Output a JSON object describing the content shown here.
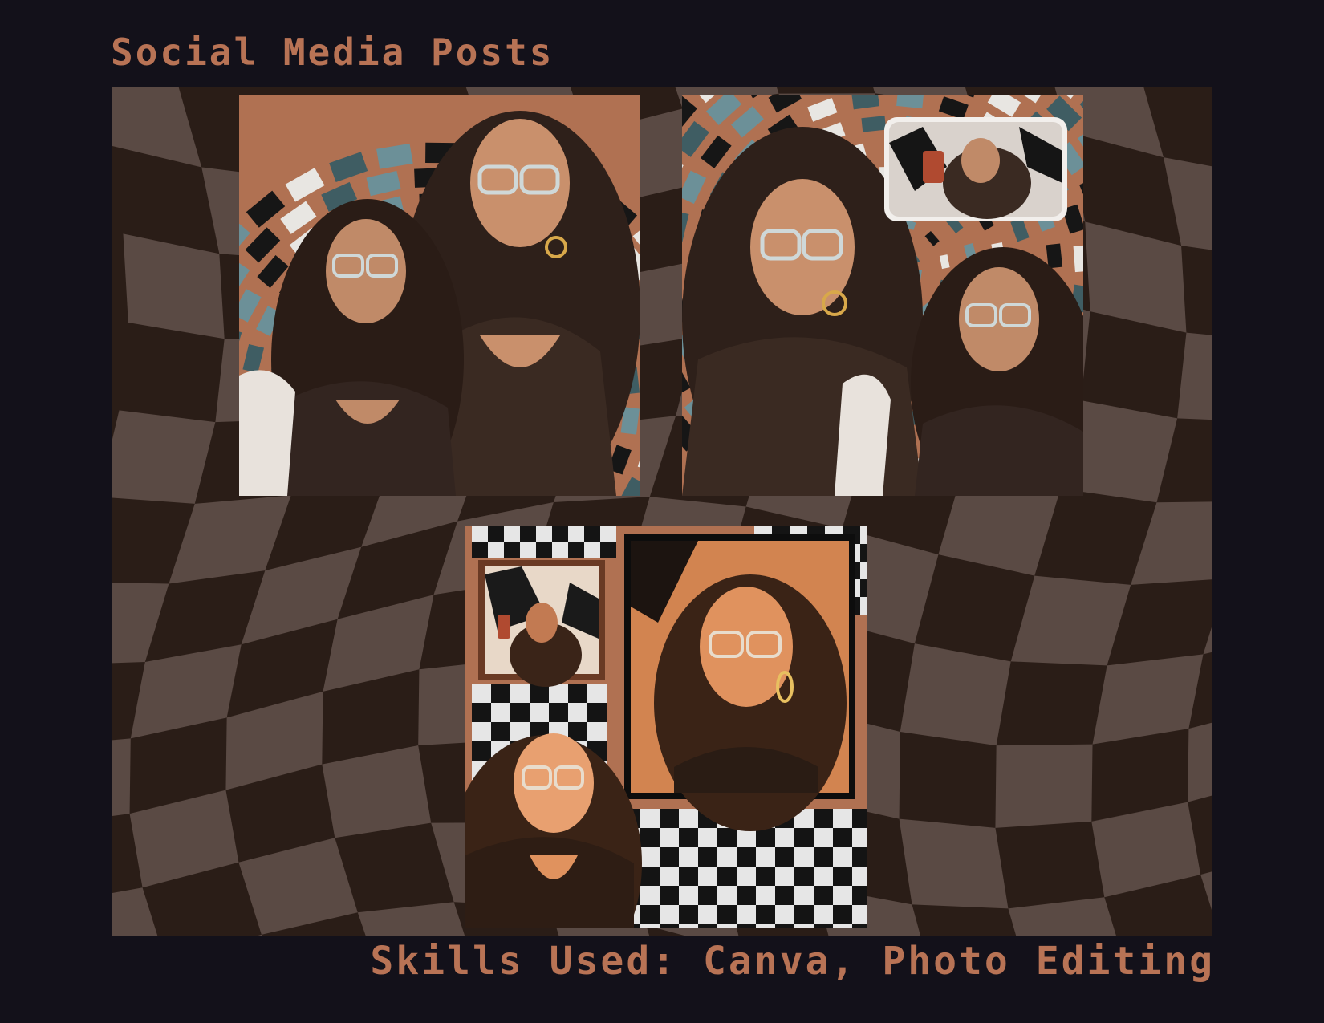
{
  "header": {
    "title": "Social Media Posts"
  },
  "footer": {
    "skills": "Skills Used: Canva, Photo Editing"
  },
  "theme": {
    "accent": "#b87355",
    "background": "#13111a",
    "board_dark": "#2a1d17",
    "board_light": "#5a4a44",
    "teal": "#6c9098",
    "terracotta": "#b07152"
  },
  "posts": [
    {
      "id": "post-1",
      "label": ""
    },
    {
      "id": "post-2",
      "label": ""
    },
    {
      "id": "post-3",
      "label": ""
    }
  ]
}
